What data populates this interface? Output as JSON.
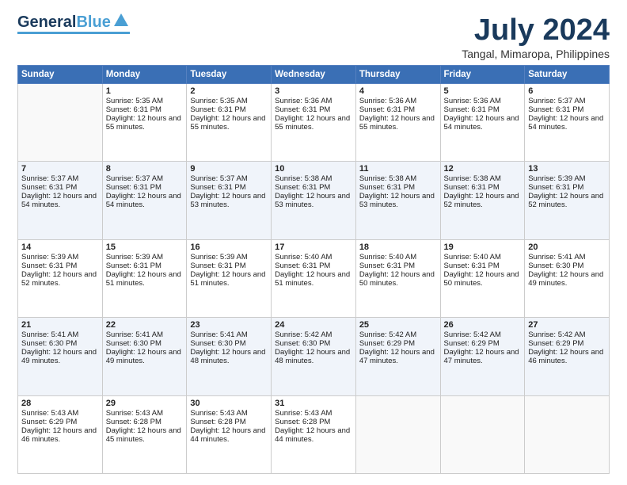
{
  "header": {
    "logo_line1": "General",
    "logo_line2": "Blue",
    "month": "July 2024",
    "location": "Tangal, Mimaropa, Philippines"
  },
  "days_of_week": [
    "Sunday",
    "Monday",
    "Tuesday",
    "Wednesday",
    "Thursday",
    "Friday",
    "Saturday"
  ],
  "weeks": [
    [
      {
        "day": "",
        "sunrise": "",
        "sunset": "",
        "daylight": ""
      },
      {
        "day": "1",
        "sunrise": "Sunrise: 5:35 AM",
        "sunset": "Sunset: 6:31 PM",
        "daylight": "Daylight: 12 hours and 55 minutes."
      },
      {
        "day": "2",
        "sunrise": "Sunrise: 5:35 AM",
        "sunset": "Sunset: 6:31 PM",
        "daylight": "Daylight: 12 hours and 55 minutes."
      },
      {
        "day": "3",
        "sunrise": "Sunrise: 5:36 AM",
        "sunset": "Sunset: 6:31 PM",
        "daylight": "Daylight: 12 hours and 55 minutes."
      },
      {
        "day": "4",
        "sunrise": "Sunrise: 5:36 AM",
        "sunset": "Sunset: 6:31 PM",
        "daylight": "Daylight: 12 hours and 55 minutes."
      },
      {
        "day": "5",
        "sunrise": "Sunrise: 5:36 AM",
        "sunset": "Sunset: 6:31 PM",
        "daylight": "Daylight: 12 hours and 54 minutes."
      },
      {
        "day": "6",
        "sunrise": "Sunrise: 5:37 AM",
        "sunset": "Sunset: 6:31 PM",
        "daylight": "Daylight: 12 hours and 54 minutes."
      }
    ],
    [
      {
        "day": "7",
        "sunrise": "Sunrise: 5:37 AM",
        "sunset": "Sunset: 6:31 PM",
        "daylight": "Daylight: 12 hours and 54 minutes."
      },
      {
        "day": "8",
        "sunrise": "Sunrise: 5:37 AM",
        "sunset": "Sunset: 6:31 PM",
        "daylight": "Daylight: 12 hours and 54 minutes."
      },
      {
        "day": "9",
        "sunrise": "Sunrise: 5:37 AM",
        "sunset": "Sunset: 6:31 PM",
        "daylight": "Daylight: 12 hours and 53 minutes."
      },
      {
        "day": "10",
        "sunrise": "Sunrise: 5:38 AM",
        "sunset": "Sunset: 6:31 PM",
        "daylight": "Daylight: 12 hours and 53 minutes."
      },
      {
        "day": "11",
        "sunrise": "Sunrise: 5:38 AM",
        "sunset": "Sunset: 6:31 PM",
        "daylight": "Daylight: 12 hours and 53 minutes."
      },
      {
        "day": "12",
        "sunrise": "Sunrise: 5:38 AM",
        "sunset": "Sunset: 6:31 PM",
        "daylight": "Daylight: 12 hours and 52 minutes."
      },
      {
        "day": "13",
        "sunrise": "Sunrise: 5:39 AM",
        "sunset": "Sunset: 6:31 PM",
        "daylight": "Daylight: 12 hours and 52 minutes."
      }
    ],
    [
      {
        "day": "14",
        "sunrise": "Sunrise: 5:39 AM",
        "sunset": "Sunset: 6:31 PM",
        "daylight": "Daylight: 12 hours and 52 minutes."
      },
      {
        "day": "15",
        "sunrise": "Sunrise: 5:39 AM",
        "sunset": "Sunset: 6:31 PM",
        "daylight": "Daylight: 12 hours and 51 minutes."
      },
      {
        "day": "16",
        "sunrise": "Sunrise: 5:39 AM",
        "sunset": "Sunset: 6:31 PM",
        "daylight": "Daylight: 12 hours and 51 minutes."
      },
      {
        "day": "17",
        "sunrise": "Sunrise: 5:40 AM",
        "sunset": "Sunset: 6:31 PM",
        "daylight": "Daylight: 12 hours and 51 minutes."
      },
      {
        "day": "18",
        "sunrise": "Sunrise: 5:40 AM",
        "sunset": "Sunset: 6:31 PM",
        "daylight": "Daylight: 12 hours and 50 minutes."
      },
      {
        "day": "19",
        "sunrise": "Sunrise: 5:40 AM",
        "sunset": "Sunset: 6:31 PM",
        "daylight": "Daylight: 12 hours and 50 minutes."
      },
      {
        "day": "20",
        "sunrise": "Sunrise: 5:41 AM",
        "sunset": "Sunset: 6:30 PM",
        "daylight": "Daylight: 12 hours and 49 minutes."
      }
    ],
    [
      {
        "day": "21",
        "sunrise": "Sunrise: 5:41 AM",
        "sunset": "Sunset: 6:30 PM",
        "daylight": "Daylight: 12 hours and 49 minutes."
      },
      {
        "day": "22",
        "sunrise": "Sunrise: 5:41 AM",
        "sunset": "Sunset: 6:30 PM",
        "daylight": "Daylight: 12 hours and 49 minutes."
      },
      {
        "day": "23",
        "sunrise": "Sunrise: 5:41 AM",
        "sunset": "Sunset: 6:30 PM",
        "daylight": "Daylight: 12 hours and 48 minutes."
      },
      {
        "day": "24",
        "sunrise": "Sunrise: 5:42 AM",
        "sunset": "Sunset: 6:30 PM",
        "daylight": "Daylight: 12 hours and 48 minutes."
      },
      {
        "day": "25",
        "sunrise": "Sunrise: 5:42 AM",
        "sunset": "Sunset: 6:29 PM",
        "daylight": "Daylight: 12 hours and 47 minutes."
      },
      {
        "day": "26",
        "sunrise": "Sunrise: 5:42 AM",
        "sunset": "Sunset: 6:29 PM",
        "daylight": "Daylight: 12 hours and 47 minutes."
      },
      {
        "day": "27",
        "sunrise": "Sunrise: 5:42 AM",
        "sunset": "Sunset: 6:29 PM",
        "daylight": "Daylight: 12 hours and 46 minutes."
      }
    ],
    [
      {
        "day": "28",
        "sunrise": "Sunrise: 5:43 AM",
        "sunset": "Sunset: 6:29 PM",
        "daylight": "Daylight: 12 hours and 46 minutes."
      },
      {
        "day": "29",
        "sunrise": "Sunrise: 5:43 AM",
        "sunset": "Sunset: 6:28 PM",
        "daylight": "Daylight: 12 hours and 45 minutes."
      },
      {
        "day": "30",
        "sunrise": "Sunrise: 5:43 AM",
        "sunset": "Sunset: 6:28 PM",
        "daylight": "Daylight: 12 hours and 44 minutes."
      },
      {
        "day": "31",
        "sunrise": "Sunrise: 5:43 AM",
        "sunset": "Sunset: 6:28 PM",
        "daylight": "Daylight: 12 hours and 44 minutes."
      },
      {
        "day": "",
        "sunrise": "",
        "sunset": "",
        "daylight": ""
      },
      {
        "day": "",
        "sunrise": "",
        "sunset": "",
        "daylight": ""
      },
      {
        "day": "",
        "sunrise": "",
        "sunset": "",
        "daylight": ""
      }
    ]
  ]
}
